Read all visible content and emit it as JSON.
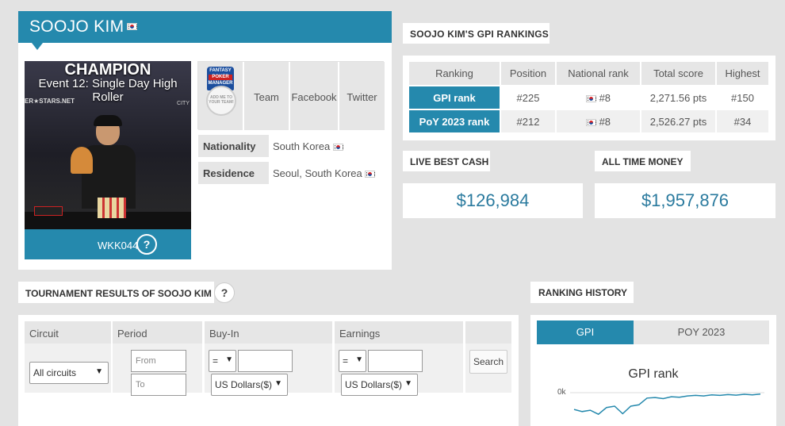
{
  "player": {
    "name": "SOOJO KIM",
    "photo": {
      "title": "CHAMPION",
      "event": "Event 12: Single Day High Roller",
      "sponsor_left": "ER★STARS.NET",
      "sponsor_right": "CITY"
    },
    "code": "WKK044",
    "help": "?"
  },
  "social": {
    "fpm_line1": "FANTASY",
    "fpm_line2": "POKER",
    "fpm_line3": "MANAGER",
    "fpm_cta": "ADD ME TO YOUR TEAM!",
    "team": "Team",
    "facebook": "Facebook",
    "twitter": "Twitter"
  },
  "info": {
    "nationality_label": "Nationality",
    "nationality_value": "South Korea",
    "residence_label": "Residence",
    "residence_value": "Seoul, South Korea"
  },
  "rankings": {
    "title": "SOOJO KIM'S GPI RANKINGS",
    "headers": [
      "Ranking",
      "Position",
      "National rank",
      "Total score",
      "Highest"
    ],
    "rows": [
      {
        "ranking": "GPI rank",
        "position": "#225",
        "national": "#8",
        "score": "2,271.56 pts",
        "highest": "#150"
      },
      {
        "ranking": "PoY 2023 rank",
        "position": "#212",
        "national": "#8",
        "score": "2,526.27 pts",
        "highest": "#34"
      }
    ]
  },
  "money": {
    "live_best_cash_label": "LIVE BEST CASH",
    "live_best_cash_value": "$126,984",
    "all_time_label": "ALL TIME MONEY",
    "all_time_value": "$1,957,876"
  },
  "tournament": {
    "title": "TOURNAMENT RESULTS OF SOOJO KIM",
    "help": "?",
    "circuit_label": "Circuit",
    "period_label": "Period",
    "buyin_label": "Buy-In",
    "earnings_label": "Earnings",
    "circuit_value": "All circuits",
    "from_placeholder": "From",
    "to_placeholder": "To",
    "operator_buyin": "=",
    "operator_earnings": "=",
    "currency_buyin": "US Dollars($)",
    "currency_earnings": "US Dollars($)",
    "search_label": "Search"
  },
  "history": {
    "title": "RANKING HISTORY",
    "tab_gpi": "GPI",
    "tab_poy": "POY 2023",
    "chart_title": "GPI rank",
    "y_tick": "0k"
  },
  "colors": {
    "accent": "#2589ad",
    "money": "#2a7a9e",
    "chart_line": "#2589ad"
  },
  "chart_data": {
    "type": "line",
    "title": "GPI rank",
    "yticks": [
      "0k"
    ],
    "series": [
      {
        "values": [
          0.62,
          0.7,
          0.65,
          0.8,
          0.55,
          0.5,
          0.78,
          0.5,
          0.45,
          0.2,
          0.18,
          0.22,
          0.15,
          0.17,
          0.12,
          0.1,
          0.12,
          0.08,
          0.1,
          0.07,
          0.09,
          0.06,
          0.08,
          0.05
        ]
      }
    ]
  }
}
